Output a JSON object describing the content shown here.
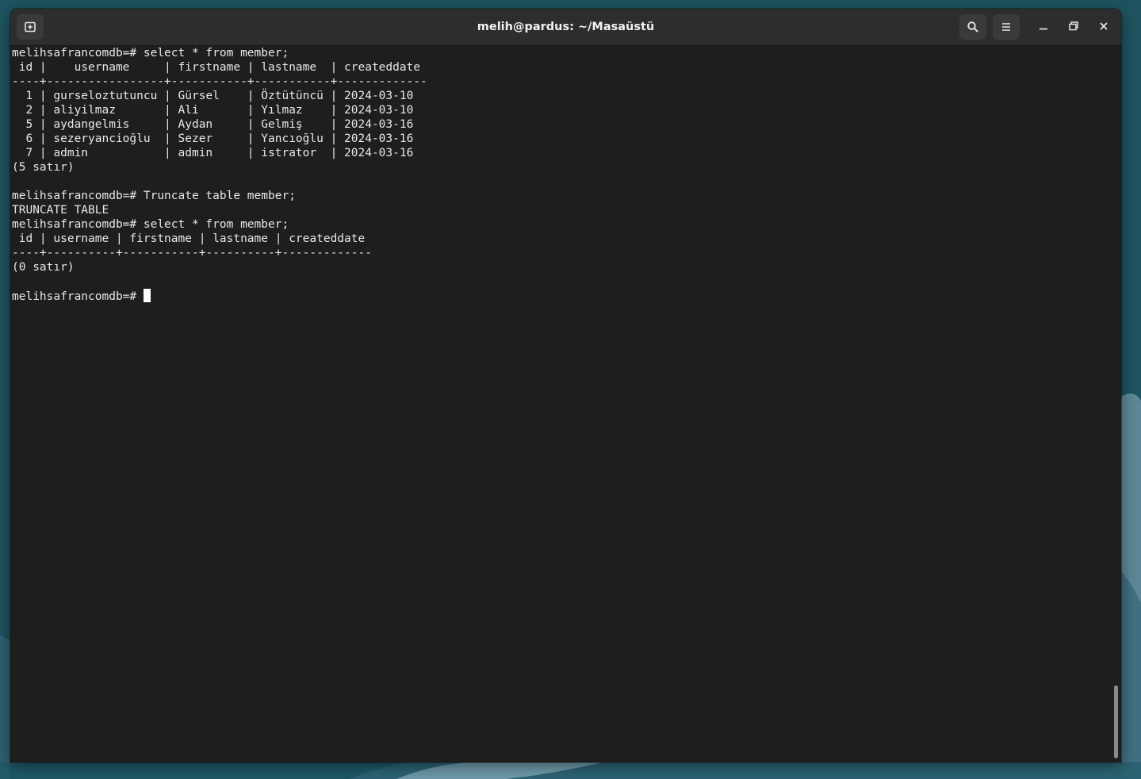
{
  "window": {
    "title": "melih@pardus: ~/Masaüstü"
  },
  "headerbar": {
    "new_tab_icon": "new-tab-icon",
    "search_icon": "search-icon",
    "menu_icon": "hamburger-menu-icon",
    "minimize_icon": "minimize-icon",
    "maximize_icon": "maximize-icon",
    "close_icon": "close-icon"
  },
  "terminal": {
    "lines": [
      "melihsafrancomdb=# select * from member;",
      " id |    username     | firstname | lastname  | createddate",
      "----+-----------------+-----------+-----------+-------------",
      "  1 | gurseloztutuncu | Gürsel    | Öztütüncü | 2024-03-10",
      "  2 | aliyilmaz       | Ali       | Yılmaz    | 2024-03-10",
      "  5 | aydangelmis     | Aydan     | Gelmiş    | 2024-03-16",
      "  6 | sezeryancioğlu  | Sezer     | Yancıoğlu | 2024-03-16",
      "  7 | admin           | admin     | istrator  | 2024-03-16",
      "(5 satır)",
      "",
      "melihsafrancomdb=# Truncate table member;",
      "TRUNCATE TABLE",
      "melihsafrancomdb=# select * from member;",
      " id | username | firstname | lastname | createddate",
      "----+----------+-----------+----------+-------------",
      "(0 satır)",
      ""
    ],
    "prompt": "melihsafrancomdb=# "
  },
  "colors": {
    "terminal_bg": "#1e1e1e",
    "headerbar_bg": "#2d2d2d",
    "text": "#e8e8e8",
    "desktop": "#1e5560"
  }
}
